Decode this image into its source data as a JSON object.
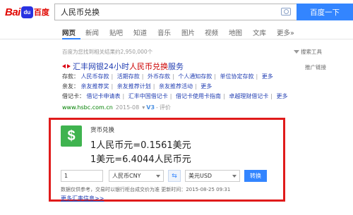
{
  "header": {
    "logo_bai": "Bai",
    "logo_du": "du",
    "logo_cn": "百度",
    "search_value": "人民币兑换",
    "search_button": "百度一下"
  },
  "tabs": [
    "网页",
    "新闻",
    "贴吧",
    "知道",
    "音乐",
    "图片",
    "视频",
    "地图",
    "文库",
    "更多»"
  ],
  "result_count": "百度为您找到相关结果约2,950,000个",
  "search_tools": "搜索工具",
  "ad": {
    "title_prefix": "汇丰网银24小时",
    "title_em": "人民币兑换",
    "title_suffix": "服务",
    "promo": "推广链接",
    "row1": {
      "label": "存款：",
      "links": [
        "人民币存款",
        "活期存款",
        "外币存款",
        "个人通知存款",
        "单位协定存款"
      ],
      "more": "更多"
    },
    "row2": {
      "label": "亲友：",
      "links": [
        "亲友推荐奖",
        "亲友推荐计划",
        "亲友推荐活动"
      ],
      "more": "更多"
    },
    "row3": {
      "label": "借记卡：",
      "links": [
        "借记卡申请表",
        "汇丰中国借记卡",
        "借记卡使用卡指南",
        "卓越理财借记卡"
      ],
      "more": "更多"
    },
    "url": "www.hsbc.com.cn",
    "date": "2015-08",
    "v_badge": "V3",
    "rating": "评价"
  },
  "converter": {
    "title": "货币兑换",
    "rate1": "1人民币元=0.1561美元",
    "rate2": "1美元=6.4044人民币元",
    "amount": "1",
    "from_currency": "人民币CNY",
    "swap_symbol": "⇆",
    "to_currency": "美元USD",
    "convert_button": "转换",
    "disclaimer": "数据仅供参考，交易时以银行柜台成交价为准 更新时间：2015-08-25 09:31",
    "more_link": "更多汇率信息>>"
  }
}
